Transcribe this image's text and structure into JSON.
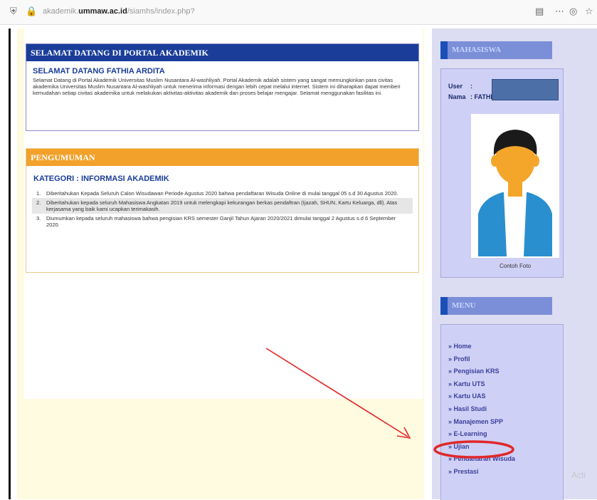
{
  "browser": {
    "url_prefix": "akademik.",
    "url_domain": "ummaw.ac.id",
    "url_path": "/siamhs/index.php?"
  },
  "welcome": {
    "header": "SELAMAT DATANG DI PORTAL AKADEMIK",
    "title": "SELAMAT DATANG FATHIA ARDITA",
    "text": "Selamat Datang di Portal Akademik Universitas Muslim Nusantara Al-washliyah. Portal Akademik adalah sistem yang sangat memungkinkan para civitas akademika Universitas Muslim Nusantara Al-washliyah untuk menerima informasi dengan lebih cepat melalui internet. Sistem ini diharapkan dapat memberi kemudahan setiap civitas akademika untuk melakukan aktivitas-aktivitas akademik dan proses belajar mengajar. Selamat menggunakan fasilitas ini."
  },
  "news": {
    "header": "PENGUMUMAN",
    "category": "KATEGORI : INFORMASI AKADEMIK",
    "items": [
      {
        "num": "1.",
        "text": "Diberitahukan Kepada Seluruh Calon Wisudawan Periode Agustus 2020 bahwa pendaftaran Wisuda Online di mulai tanggal 05 s.d 30 Agustus 2020."
      },
      {
        "num": "2.",
        "text": "Diberitahukan kepada seluruh Mahasiswa Angkatan 2019 untuk melengkapi kekurangan berkas pendaftran (Ijazah, SHUN, Kartu Keluarga, dll). Atas kerjasama yang baik kami ucapkan terimakasih."
      },
      {
        "num": "3.",
        "text": "Diumumkan kepada seluruh mahasiswa bahwa pengisian KRS semester Ganjil Tahun Ajaran 2020/2021 dimulai tanggal 2 Agustus s.d 6 September 2020."
      }
    ]
  },
  "sidebar": {
    "account_header": "MAHASISWA",
    "user_label": "User",
    "user_value": ":",
    "name_label": "Nama",
    "name_value": ": FATHIA ARDITA",
    "photo_caption": "Contoh Foto",
    "menu_header": "MENU",
    "menu": [
      "» Home",
      "» Profil",
      "» Pengisian KRS",
      "» Kartu UTS",
      "» Kartu UAS",
      "» Hasil Studi",
      "» Manajemen SPP",
      "» E-Learning",
      "» Ujian",
      "» Pendaftaran Wisuda",
      "» Prestasi"
    ]
  },
  "watermark": "Acti",
  "colors": {
    "annotation_red": "#e0282a",
    "menu_text": "#3a3f9a"
  }
}
